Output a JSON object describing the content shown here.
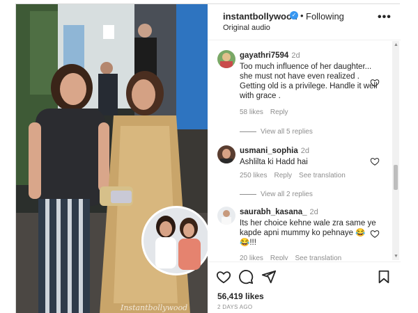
{
  "post": {
    "username": "instantbollywood",
    "separator": "•",
    "follow_status": "Following",
    "audio_label": "Original audio",
    "more_label": "•••",
    "watermark": "Instantbollywood"
  },
  "comments": [
    {
      "username": "gayathri7594",
      "time": "2d",
      "text": "Too much influence of her daughter... she must not have even realized . Getting old is a privilege. Handle it well with grace .",
      "likes": "58 likes",
      "reply": "Reply",
      "translate": "",
      "view_replies": "View all 5 replies"
    },
    {
      "username": "usmani_sophia",
      "time": "2d",
      "text": "Ashlilta ki Hadd hai",
      "likes": "250 likes",
      "reply": "Reply",
      "translate": "See translation",
      "view_replies": "View all 2 replies"
    },
    {
      "username": "saurabh_kasana_",
      "time": "2d",
      "text": "Its her choice kehne wale zra same ye kapde apni mummy ko pehnaye 😂😂!!!",
      "likes": "20 likes",
      "reply": "Reply",
      "translate": "See translation",
      "view_replies": ""
    }
  ],
  "footer": {
    "likes": "56,419 likes",
    "time_ago": "2 DAYS AGO"
  },
  "icons": {
    "like": "heart-icon",
    "comment": "comment-icon",
    "share": "paper-plane-icon",
    "save": "bookmark-icon",
    "more": "ellipsis-icon",
    "verified": "verified-badge-icon"
  },
  "colors": {
    "verified": "#3897f0",
    "muted": "#8e8e8e",
    "text": "#262626"
  }
}
